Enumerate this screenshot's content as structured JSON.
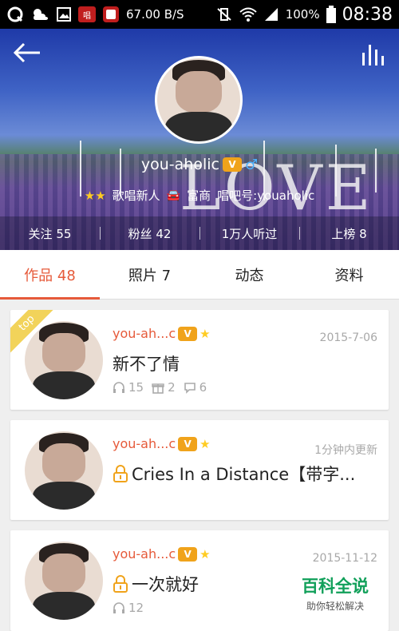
{
  "status_bar": {
    "app_icon_label": "唱",
    "net_speed": "67.00 B/S",
    "battery": "100%",
    "time": "08:38"
  },
  "profile": {
    "username": "you-aholic",
    "vip_badge": "V",
    "tags": {
      "level": "歌唱新人",
      "wealth": "富商",
      "id": "唱吧号:youaholic"
    },
    "background_text": "LOVE",
    "stats": [
      {
        "label": "关注",
        "value": "55"
      },
      {
        "label": "粉丝",
        "value": "42"
      },
      {
        "label": "1万人听过",
        "value": ""
      },
      {
        "label": "上榜",
        "value": "8"
      }
    ]
  },
  "tabs": [
    {
      "label": "作品 48"
    },
    {
      "label": "照片 7"
    },
    {
      "label": "动态"
    },
    {
      "label": "资料"
    }
  ],
  "works": [
    {
      "ribbon": "top",
      "author": "you-ah...c",
      "date": "2015-7-06",
      "title": "新不了情",
      "locked": false,
      "plays": "15",
      "gifts": "2",
      "comments": "6"
    },
    {
      "author": "you-ah...c",
      "date": "1分钟内更新",
      "title": "Cries In a Distance【带字...",
      "locked": true
    },
    {
      "author": "you-ah...c",
      "date": "2015-11-12",
      "title": "一次就好",
      "locked": true,
      "plays": "12"
    }
  ],
  "watermark": {
    "title": "百科全说",
    "subtitle": "助你轻松解决"
  },
  "colors": {
    "accent": "#e65a3a",
    "badge": "#f0a31b",
    "watermark": "#11a05a"
  }
}
